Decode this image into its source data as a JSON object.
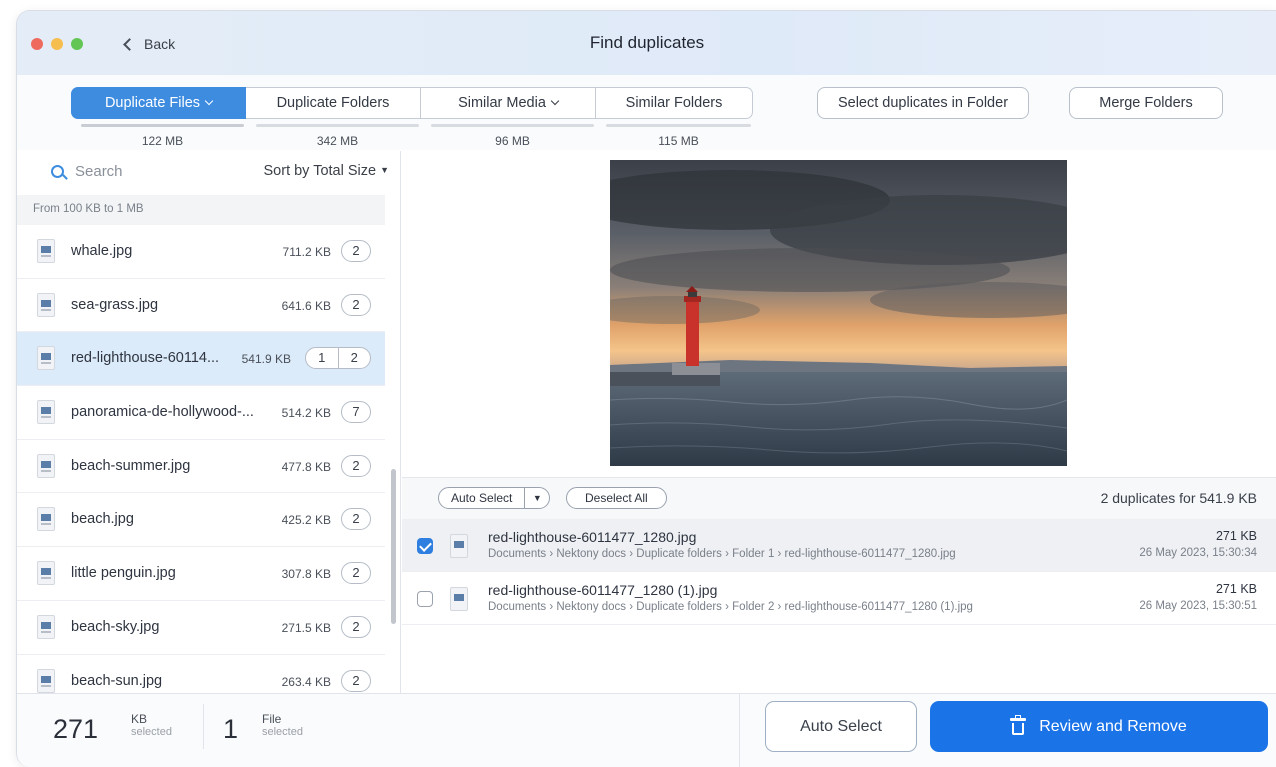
{
  "window": {
    "title": "Find duplicates",
    "back_label": "Back"
  },
  "tabs": [
    {
      "label": "Duplicate Files",
      "size": "122 MB",
      "active": true,
      "dropdown": true
    },
    {
      "label": "Duplicate Folders",
      "size": "342 MB",
      "active": false,
      "dropdown": false
    },
    {
      "label": "Similar Media",
      "size": "96 MB",
      "active": false,
      "dropdown": true
    },
    {
      "label": "Similar Folders",
      "size": "115 MB",
      "active": false,
      "dropdown": false
    }
  ],
  "toolbar": {
    "select_in_folder": "Select duplicates in Folder",
    "merge_folders": "Merge Folders"
  },
  "sidebar": {
    "search_placeholder": "Search",
    "sort_label": "Sort by Total Size",
    "group_header": "From 100 KB to 1 MB",
    "files": [
      {
        "name": "whale.jpg",
        "size": "711.2 KB",
        "count": "2"
      },
      {
        "name": "sea-grass.jpg",
        "size": "641.6 KB",
        "count": "2"
      },
      {
        "name": "red-lighthouse-60114...",
        "size": "541.9 KB",
        "selected_count": "1",
        "count": "2"
      },
      {
        "name": "panoramica-de-hollywood-...",
        "size": "514.2 KB",
        "count": "7"
      },
      {
        "name": "beach-summer.jpg",
        "size": "477.8 KB",
        "count": "2"
      },
      {
        "name": "beach.jpg",
        "size": "425.2 KB",
        "count": "2"
      },
      {
        "name": "little penguin.jpg",
        "size": "307.8 KB",
        "count": "2"
      },
      {
        "name": "beach-sky.jpg",
        "size": "271.5 KB",
        "count": "2"
      },
      {
        "name": "beach-sun.jpg",
        "size": "263.4 KB",
        "count": "2"
      }
    ]
  },
  "actions": {
    "auto_select": "Auto Select",
    "deselect_all": "Deselect All",
    "summary": "2 duplicates for 541.9 KB"
  },
  "duplicates": [
    {
      "name": "red-lighthouse-6011477_1280.jpg",
      "path": "Documents › Nektony docs › Duplicate folders › Folder 1 › red-lighthouse-6011477_1280.jpg",
      "size": "271 KB",
      "date": "26 May 2023, 15:30:34",
      "checked": true
    },
    {
      "name": "red-lighthouse-6011477_1280 (1).jpg",
      "path": "Documents › Nektony docs › Duplicate folders › Folder 2 › red-lighthouse-6011477_1280 (1).jpg",
      "size": "271 KB",
      "date": "26 May 2023, 15:30:51",
      "checked": false
    }
  ],
  "footer": {
    "size_value": "271",
    "size_unit": "KB",
    "size_caption": "selected",
    "files_value": "1",
    "files_unit": "File",
    "files_caption": "selected",
    "auto_select": "Auto Select",
    "review_remove": "Review and Remove"
  },
  "colors": {
    "accent": "#3d8ce0",
    "primary_button": "#1a74e8",
    "selected_row": "#dcebf9"
  },
  "icons": [
    "search-icon",
    "chevron-left-icon",
    "chevron-down-icon",
    "file-icon",
    "trash-icon",
    "checkbox-icon"
  ]
}
